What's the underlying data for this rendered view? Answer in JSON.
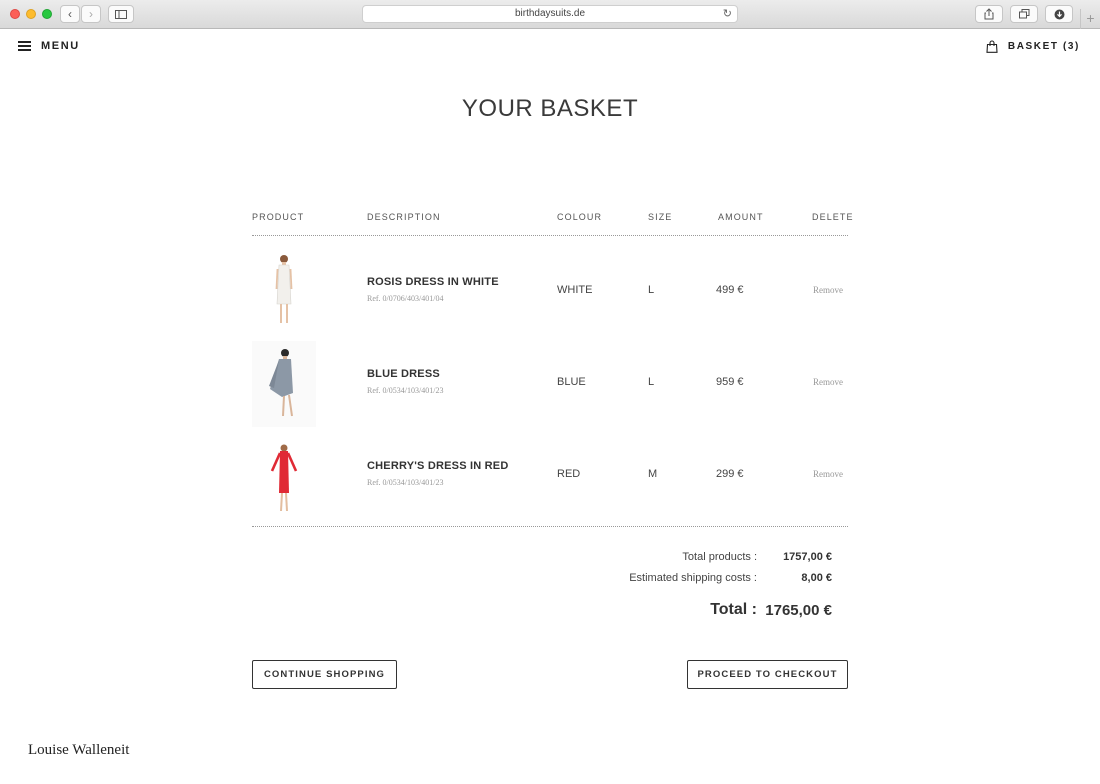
{
  "browser": {
    "url": "birthdaysuits.de",
    "back_icon": "chevron-left-icon",
    "forward_icon": "chevron-right-icon"
  },
  "header": {
    "menu_label": "MENU",
    "basket_label": "BASKET (3)"
  },
  "page": {
    "title": "YOUR BASKET"
  },
  "table": {
    "columns": [
      "PRODUCT",
      "DESCRIPTION",
      "COLOUR",
      "SIZE",
      "AMOUNT",
      "DELETE"
    ],
    "items": [
      {
        "name": "ROSIS DRESS IN WHITE",
        "ref": "Ref. 0/0706/403/401/04",
        "colour": "WHITE",
        "size": "L",
        "amount": "499 €",
        "delete": "Remove",
        "dress_color": "#f2f0ec"
      },
      {
        "name": "BLUE DRESS",
        "ref": "Ref. 0/0534/103/401/23",
        "colour": "BLUE",
        "size": "L",
        "amount": "959 €",
        "delete": "Remove",
        "dress_color": "#8c98a6"
      },
      {
        "name": "CHERRY'S DRESS IN RED",
        "ref": "Ref. 0/0534/103/401/23",
        "colour": "RED",
        "size": "M",
        "amount": "299 €",
        "delete": "Remove",
        "dress_color": "#e02a35"
      }
    ]
  },
  "totals": {
    "products_label": "Total products :",
    "products_value": "1757,00 €",
    "shipping_label": "Estimated shipping costs :",
    "shipping_value": "8,00 €",
    "total_label": "Total :",
    "total_value": "1765,00 €"
  },
  "actions": {
    "continue_label": "CONTINUE SHOPPING",
    "checkout_label": "PROCEED TO CHECKOUT"
  },
  "footer": {
    "brand": "Louise Walleneit"
  }
}
